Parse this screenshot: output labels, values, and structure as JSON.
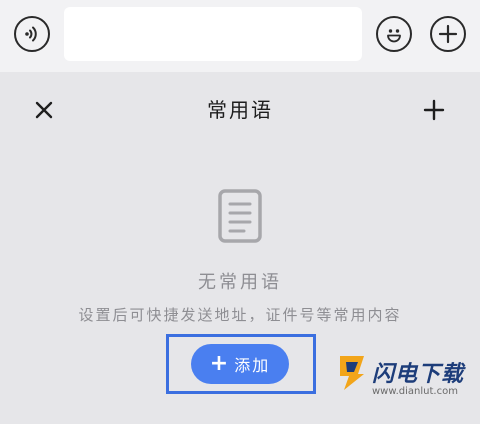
{
  "input_bar": {
    "voice_icon": "voice-icon",
    "input_value": "",
    "input_placeholder": "",
    "emoji_icon": "emoji-icon",
    "plus_icon": "plus-icon"
  },
  "panel": {
    "title": "常用语",
    "close_icon": "close-icon",
    "add_icon": "plus-icon",
    "empty_state": {
      "icon": "document-icon",
      "title": "无常用语",
      "description": "设置后可快捷发送地址，证件号等常用内容"
    },
    "add_button": {
      "glyph": "+",
      "label": "添加"
    }
  },
  "watermark": {
    "name": "闪电下载",
    "url": "www.dianlut.com"
  },
  "colors": {
    "panel_background": "#e6e6e9",
    "input_bar_background": "#f2f2f4",
    "accent_button": "#4a7ff0",
    "highlight_border": "#3b6fe0",
    "muted_text": "#8e8e93"
  }
}
